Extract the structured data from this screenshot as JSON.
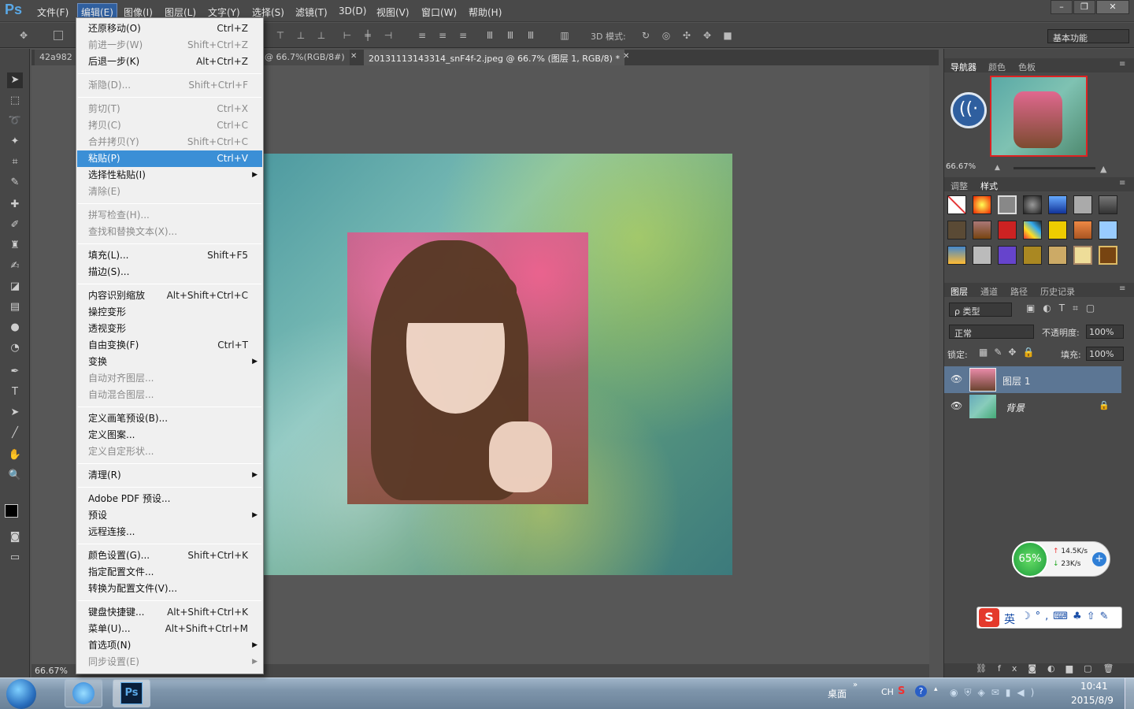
{
  "app": {
    "logo": "Ps"
  },
  "menubar": {
    "items": [
      "文件(F)",
      "编辑(E)",
      "图像(I)",
      "图层(L)",
      "文字(Y)",
      "选择(S)",
      "滤镜(T)",
      "3D(D)",
      "视图(V)",
      "窗口(W)",
      "帮助(H)"
    ],
    "active": "编辑(E)"
  },
  "options": {
    "mode_3d_label": "3D 模式:",
    "workspace": "基本功能"
  },
  "tabs": [
    {
      "label": "42a982"
    },
    {
      "label": "@ 66.7%(RGB/8#)"
    },
    {
      "label": "20131113143314_snF4f-2.jpeg @ 66.7% (图层 1, RGB/8) *"
    }
  ],
  "edit_menu": {
    "groups": [
      [
        {
          "label": "还原移动(O)",
          "shortcut": "Ctrl+Z",
          "disabled": false
        },
        {
          "label": "前进一步(W)",
          "shortcut": "Shift+Ctrl+Z",
          "disabled": true
        },
        {
          "label": "后退一步(K)",
          "shortcut": "Alt+Ctrl+Z",
          "disabled": false
        }
      ],
      [
        {
          "label": "渐隐(D)...",
          "shortcut": "Shift+Ctrl+F",
          "disabled": true
        }
      ],
      [
        {
          "label": "剪切(T)",
          "shortcut": "Ctrl+X",
          "disabled": true
        },
        {
          "label": "拷贝(C)",
          "shortcut": "Ctrl+C",
          "disabled": true
        },
        {
          "label": "合并拷贝(Y)",
          "shortcut": "Shift+Ctrl+C",
          "disabled": true
        },
        {
          "label": "粘贴(P)",
          "shortcut": "Ctrl+V",
          "disabled": false,
          "selected": true
        },
        {
          "label": "选择性粘贴(I)",
          "shortcut": "",
          "submenu": true,
          "disabled": false
        },
        {
          "label": "清除(E)",
          "shortcut": "",
          "disabled": true
        }
      ],
      [
        {
          "label": "拼写检查(H)...",
          "shortcut": "",
          "disabled": true
        },
        {
          "label": "查找和替换文本(X)...",
          "shortcut": "",
          "disabled": true
        }
      ],
      [
        {
          "label": "填充(L)...",
          "shortcut": "Shift+F5",
          "disabled": false
        },
        {
          "label": "描边(S)...",
          "shortcut": "",
          "disabled": false
        }
      ],
      [
        {
          "label": "内容识别缩放",
          "shortcut": "Alt+Shift+Ctrl+C",
          "disabled": false
        },
        {
          "label": "操控变形",
          "shortcut": "",
          "disabled": false
        },
        {
          "label": "透视变形",
          "shortcut": "",
          "disabled": false
        },
        {
          "label": "自由变换(F)",
          "shortcut": "Ctrl+T",
          "disabled": false
        },
        {
          "label": "变换",
          "shortcut": "",
          "submenu": true,
          "disabled": false
        },
        {
          "label": "自动对齐图层...",
          "shortcut": "",
          "disabled": true
        },
        {
          "label": "自动混合图层...",
          "shortcut": "",
          "disabled": true
        }
      ],
      [
        {
          "label": "定义画笔预设(B)...",
          "shortcut": "",
          "disabled": false
        },
        {
          "label": "定义图案...",
          "shortcut": "",
          "disabled": false
        },
        {
          "label": "定义自定形状...",
          "shortcut": "",
          "disabled": true
        }
      ],
      [
        {
          "label": "清理(R)",
          "shortcut": "",
          "submenu": true,
          "disabled": false
        }
      ],
      [
        {
          "label": "Adobe PDF 预设...",
          "shortcut": "",
          "disabled": false
        },
        {
          "label": "预设",
          "shortcut": "",
          "submenu": true,
          "disabled": false
        },
        {
          "label": "远程连接...",
          "shortcut": "",
          "disabled": false
        }
      ],
      [
        {
          "label": "颜色设置(G)...",
          "shortcut": "Shift+Ctrl+K",
          "disabled": false
        },
        {
          "label": "指定配置文件...",
          "shortcut": "",
          "disabled": false
        },
        {
          "label": "转换为配置文件(V)...",
          "shortcut": "",
          "disabled": false
        }
      ],
      [
        {
          "label": "键盘快捷键...",
          "shortcut": "Alt+Shift+Ctrl+K",
          "disabled": false
        },
        {
          "label": "菜单(U)...",
          "shortcut": "Alt+Shift+Ctrl+M",
          "disabled": false
        },
        {
          "label": "首选项(N)",
          "shortcut": "",
          "submenu": true,
          "disabled": false
        },
        {
          "label": "同步设置(E)",
          "shortcut": "",
          "submenu": true,
          "disabled": true
        }
      ]
    ]
  },
  "status": {
    "zoom": "66.67%"
  },
  "navigator": {
    "tabs": [
      "导航器",
      "颜色",
      "色板"
    ],
    "zoom": "66.67%"
  },
  "styles_panel": {
    "tabs": [
      "调整",
      "样式"
    ]
  },
  "layers_panel": {
    "tabs": [
      "图层",
      "通道",
      "路径",
      "历史记录"
    ],
    "filter_label": "ρ 类型",
    "blend_mode": "正常",
    "opacity_label": "不透明度:",
    "opacity": "100%",
    "lock_label": "锁定:",
    "fill_label": "填充:",
    "fill": "100%",
    "layers": [
      {
        "name": "图层 1",
        "selected": true
      },
      {
        "name": "背景",
        "selected": false,
        "locked": true
      }
    ]
  },
  "network_widget": {
    "percent": "65%",
    "up": "14.5K/s",
    "down": "23K/s"
  },
  "ime": {
    "lang": "英"
  },
  "taskbar": {
    "desktop_label": "桌面",
    "lang": "CH",
    "time": "10:41",
    "date": "2015/8/9"
  }
}
